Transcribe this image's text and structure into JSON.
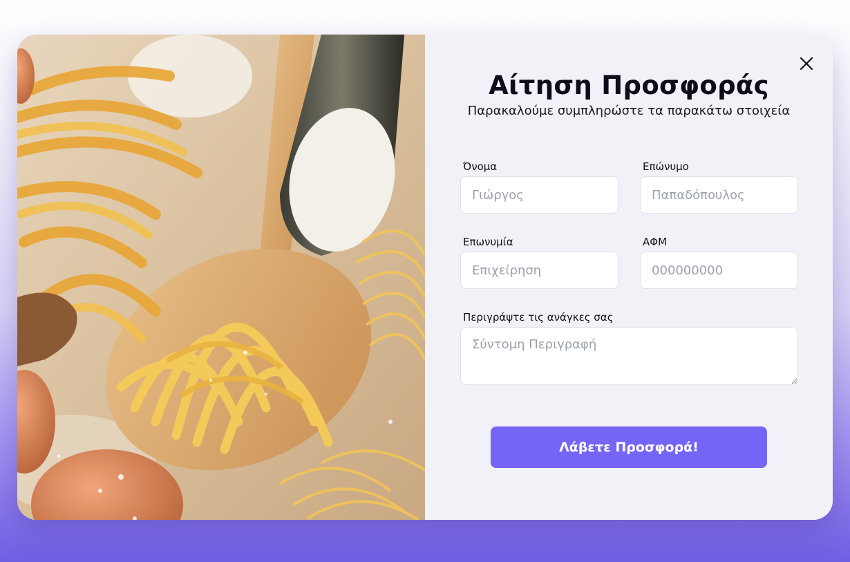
{
  "form": {
    "title": "Αίτηση Προσφοράς",
    "subtitle": "Παρακαλούμε συμπληρώστε τα παρακάτω στοιχεία",
    "close_icon": "close-icon",
    "fields": {
      "first_name": {
        "label": "Όνομα",
        "placeholder": "Γιώργος",
        "value": ""
      },
      "last_name": {
        "label": "Επώνυμο",
        "placeholder": "Παπαδόπουλος",
        "value": ""
      },
      "company": {
        "label": "Επωνυμία",
        "placeholder": "Επιχείρηση",
        "value": ""
      },
      "vat": {
        "label": "ΑΦΜ",
        "placeholder": "000000000",
        "value": ""
      },
      "description": {
        "label": "Περιγράψτε τις ανάγκες σας",
        "placeholder": "Σύντομη Περιγραφή",
        "value": ""
      }
    },
    "submit_label": "Λάβετε Προσφορά!"
  },
  "colors": {
    "accent": "#7565f5",
    "panel_background": "#f0f2f7",
    "input_border": "#dfe1ea",
    "backdrop_gradient_end": "#6f5fe3"
  }
}
